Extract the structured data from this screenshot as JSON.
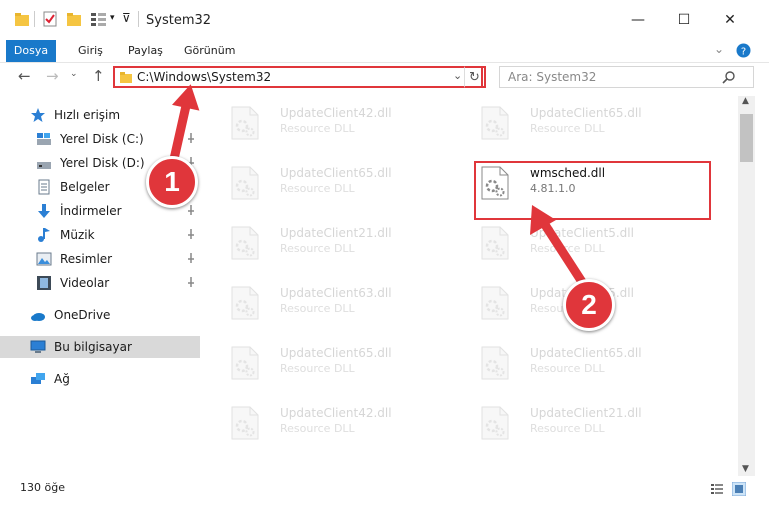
{
  "window": {
    "title": "System32",
    "minimize": "—",
    "maximize": "☐",
    "close": "✕"
  },
  "ribbon": {
    "tabs": [
      "Dosya",
      "Giriş",
      "Paylaş",
      "Görünüm"
    ]
  },
  "address": {
    "path": "C:\\Windows\\System32",
    "search_placeholder": "Ara: System32"
  },
  "nav": {
    "quick_access": "Hızlı erişim",
    "items": [
      "Yerel Disk (C:)",
      "Yerel Disk (D:)",
      "Belgeler",
      "İndirmeler",
      "Müzik",
      "Resimler",
      "Videolar"
    ],
    "onedrive": "OneDrive",
    "this_pc": "Bu bilgisayar",
    "network": "Ağ"
  },
  "files": [
    {
      "name": "UpdateClient42.dll",
      "desc": "Resource DLL"
    },
    {
      "name": "UpdateClient65.dll",
      "desc": "Resource DLL"
    },
    {
      "name": "UpdateClient65.dll",
      "desc": "Resource DLL"
    },
    {
      "name": "wmsched.dll",
      "desc": "4.81.1.0"
    },
    {
      "name": "UpdateClient21.dll",
      "desc": "Resource DLL"
    },
    {
      "name": "UpdateClient5.dll",
      "desc": "Resource DLL"
    },
    {
      "name": "UpdateClient63.dll",
      "desc": "Resource DLL"
    },
    {
      "name": "UpdateClient5.dll",
      "desc": "Resource DLL"
    },
    {
      "name": "UpdateClient65.dll",
      "desc": "Resource DLL"
    },
    {
      "name": "UpdateClient65.dll",
      "desc": "Resource DLL"
    },
    {
      "name": "UpdateClient42.dll",
      "desc": "Resource DLL"
    },
    {
      "name": "UpdateClient21.dll",
      "desc": "Resource DLL"
    }
  ],
  "status": {
    "count": "130 öğe"
  },
  "annotations": {
    "badge1": "1",
    "badge2": "2",
    "color": "#e0363b"
  }
}
